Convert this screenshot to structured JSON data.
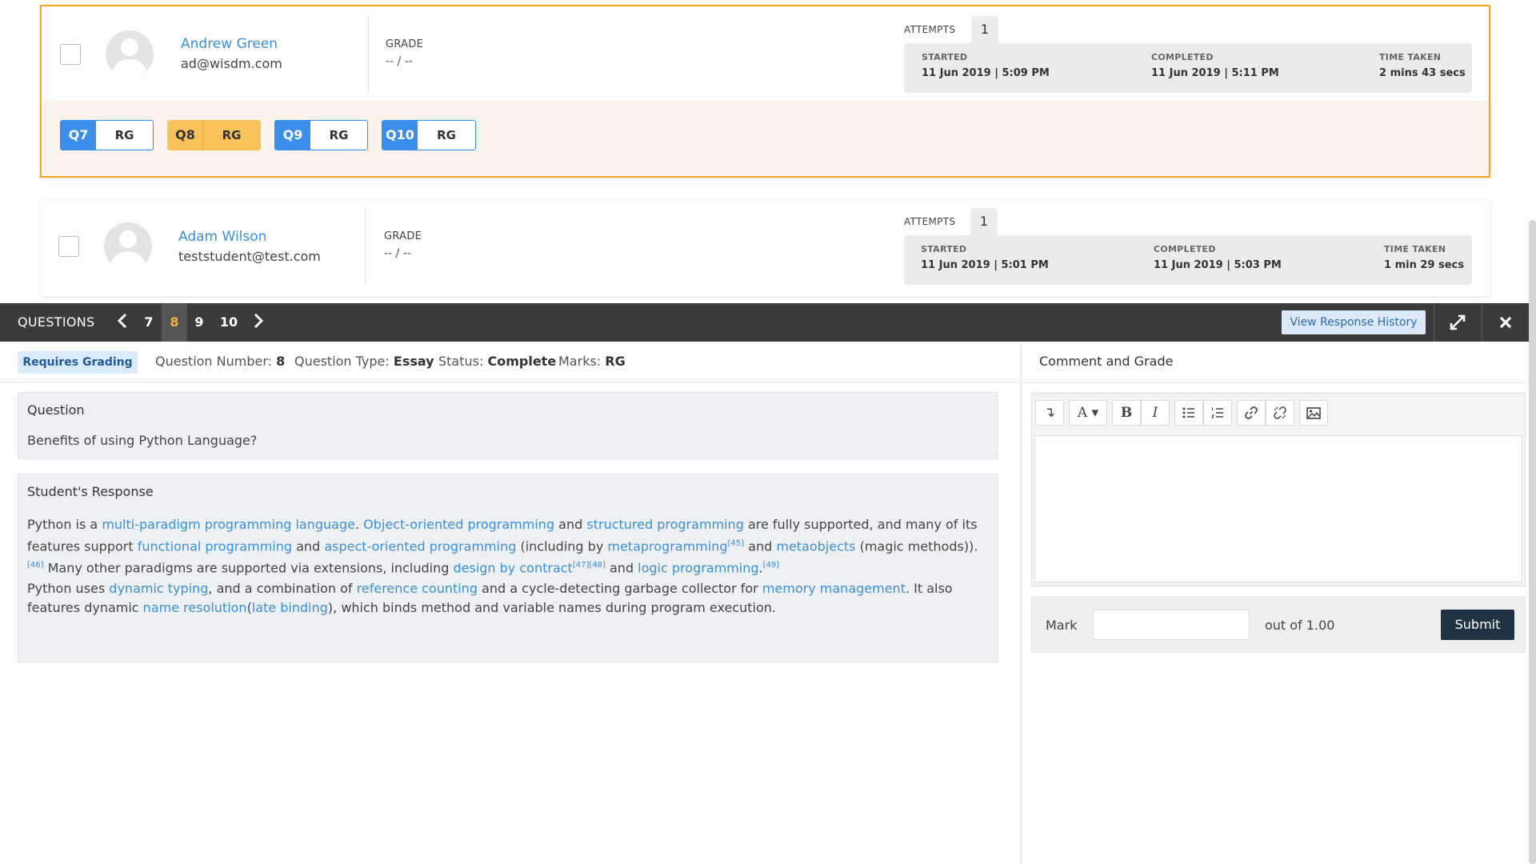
{
  "students": [
    {
      "name": "Andrew Green",
      "email": "ad@wisdm.com",
      "grade_label": "GRADE",
      "grade_value": "-- / --",
      "attempts_label": "ATTEMPTS",
      "attempts_count": "1",
      "started_label": "STARTED",
      "started": "11 Jun 2019 | 5:09 PM",
      "completed_label": "COMPLETED",
      "completed": "11 Jun 2019 | 5:11 PM",
      "time_label": "TIME TAKEN",
      "time_taken": "2 mins 43 secs",
      "questions": [
        {
          "num": "Q7",
          "status": "RG"
        },
        {
          "num": "Q8",
          "status": "RG"
        },
        {
          "num": "Q9",
          "status": "RG"
        },
        {
          "num": "Q10",
          "status": "RG"
        }
      ]
    },
    {
      "name": "Adam Wilson",
      "email": "teststudent@test.com",
      "grade_label": "GRADE",
      "grade_value": "-- / --",
      "attempts_label": "ATTEMPTS",
      "attempts_count": "1",
      "started_label": "STARTED",
      "started": "11 Jun 2019 | 5:01 PM",
      "completed_label": "COMPLETED",
      "completed": "11 Jun 2019 | 5:03 PM",
      "time_label": "TIME TAKEN",
      "time_taken": "1 min 29 secs"
    }
  ],
  "questions_bar": {
    "title": "QUESTIONS",
    "prev_icon": "chevron-left-icon",
    "next_icon": "chevron-right-icon",
    "numbers": [
      "7",
      "8",
      "9",
      "10"
    ],
    "active": "8",
    "view_history": "View Response History",
    "expand_icon": "expand-icon",
    "close_icon": "close-icon"
  },
  "info": {
    "badge": "Requires Grading",
    "qnum_label": "Question Number:",
    "qnum": "8",
    "qtype_label": "Question Type:",
    "qtype": "Essay",
    "status_label": "Status:",
    "status": "Complete",
    "marks_label": "Marks:",
    "marks": "RG"
  },
  "question": {
    "title": "Question",
    "text": "Benefits of using Python Language?"
  },
  "response": {
    "title": "Student's Response",
    "p1": {
      "t1": "Python is a ",
      "l1": "multi-paradigm programming language",
      "t2": ". ",
      "l2": "Object-oriented programming",
      "t3": " and ",
      "l3": "structured programming",
      "t4": " are fully supported, and many of its features support ",
      "l4": "functional programming",
      "t5": " and ",
      "l5": "aspect-oriented programming",
      "t6": " (including by ",
      "l6": "metaprogramming",
      "s1": "[45]",
      "t7": " and ",
      "l7": "metaobjects",
      "t8": " (magic methods)).",
      "s2": "[46]",
      "t9": " Many other paradigms are supported via extensions, including ",
      "l8": "design by contract",
      "s3": "[47][48]",
      "t10": " and ",
      "l9": "logic programming",
      "t11": ".",
      "s4": "[49]"
    },
    "p2": {
      "t1": "Python uses ",
      "l1": "dynamic typing",
      "t2": ", and a combination of ",
      "l2": "reference counting",
      "t3": " and a cycle-detecting garbage collector for ",
      "l3": "memory management",
      "t4": ". It also features dynamic ",
      "l4": "name resolution",
      "t5": "(",
      "l5": "late binding",
      "t6": "), which binds method and variable names during program execution."
    }
  },
  "comment_grade": {
    "title": "Comment and Grade",
    "toolbar": {
      "format": "↴",
      "font": "A ▾",
      "bold": "B",
      "italic": "I",
      "icons": [
        "format-icon",
        "font-color-icon",
        "bold-icon",
        "italic-icon",
        "bullet-list-icon",
        "numbered-list-icon",
        "link-icon",
        "unlink-icon",
        "image-icon"
      ]
    },
    "mark_label": "Mark",
    "mark_value": "",
    "out_of": "out of 1.00",
    "submit": "Submit"
  }
}
